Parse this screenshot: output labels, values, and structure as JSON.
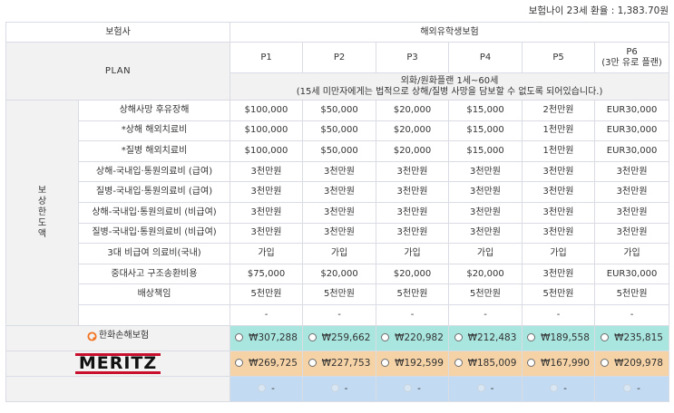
{
  "top_note": "보험나이 23세 환율 : 1,383.70원",
  "header": {
    "insurer_label": "보험사",
    "product_label": "해외유학생보험",
    "plan_label": "PLAN",
    "plans": [
      "P1",
      "P2",
      "P3",
      "P4",
      "P5",
      "P6"
    ],
    "plan6_sub": "(3만 유로 플랜)",
    "note_line1": "외화/원화플랜 1세~60세",
    "note_line2": "(15세 미만자에게는 법적으로 상해/질병 사망을 담보할 수 없도록 되어있습니다.)"
  },
  "coverage_group_label": [
    "보",
    "상",
    "한",
    "도",
    "액"
  ],
  "coverages": [
    {
      "name": "상해사망 후유장해",
      "values": [
        "$100,000",
        "$50,000",
        "$20,000",
        "$15,000",
        "2천만원",
        "EUR30,000"
      ]
    },
    {
      "name": "*상해 해외치료비",
      "values": [
        "$100,000",
        "$50,000",
        "$20,000",
        "$15,000",
        "1천만원",
        "EUR30,000"
      ]
    },
    {
      "name": "*질병 해외치료비",
      "values": [
        "$100,000",
        "$50,000",
        "$20,000",
        "$15,000",
        "1천만원",
        "EUR30,000"
      ]
    },
    {
      "name": "상해-국내입·통원의료비 (급여)",
      "values": [
        "3천만원",
        "3천만원",
        "3천만원",
        "3천만원",
        "3천만원",
        "3천만원"
      ]
    },
    {
      "name": "질병-국내입·통원의료비 (급여)",
      "values": [
        "3천만원",
        "3천만원",
        "3천만원",
        "3천만원",
        "3천만원",
        "3천만원"
      ]
    },
    {
      "name": "상해-국내입·통원의료비 (비급여)",
      "values": [
        "3천만원",
        "3천만원",
        "3천만원",
        "3천만원",
        "3천만원",
        "3천만원"
      ]
    },
    {
      "name": "질병-국내입·통원의료비 (비급여)",
      "values": [
        "3천만원",
        "3천만원",
        "3천만원",
        "3천만원",
        "3천만원",
        "3천만원"
      ]
    },
    {
      "name": "3대 비급여 의료비(국내)",
      "values": [
        "가입",
        "가입",
        "가입",
        "가입",
        "가입",
        "가입"
      ]
    },
    {
      "name": "중대사고 구조송환비용",
      "values": [
        "$75,000",
        "$20,000",
        "$20,000",
        "$20,000",
        "3천만원",
        "EUR30,000"
      ]
    },
    {
      "name": "배상책임",
      "values": [
        "5천만원",
        "5천만원",
        "5천만원",
        "5천만원",
        "5천만원",
        "5천만원"
      ]
    },
    {
      "name": "",
      "values": [
        "-",
        "-",
        "-",
        "-",
        "-",
        "-"
      ]
    }
  ],
  "insurers": [
    {
      "name": "한화손해보험",
      "premiums": [
        "₩307,288",
        "₩259,662",
        "₩220,982",
        "₩212,483",
        "₩189,558",
        "₩235,815"
      ]
    },
    {
      "name": "MERITZ",
      "premiums": [
        "₩269,725",
        "₩227,753",
        "₩192,599",
        "₩185,009",
        "₩167,990",
        "₩209,978"
      ]
    },
    {
      "name": "",
      "premiums": [
        "-",
        "-",
        "-",
        "-",
        "-",
        "-"
      ]
    }
  ],
  "colors": {
    "hanwha_row": "#a9e6e0",
    "meritz_row": "#f6d3a6",
    "empty_row": "#c2dbf2",
    "meritz_red": "#c8102e",
    "hanwha_orange": "#f37321"
  }
}
